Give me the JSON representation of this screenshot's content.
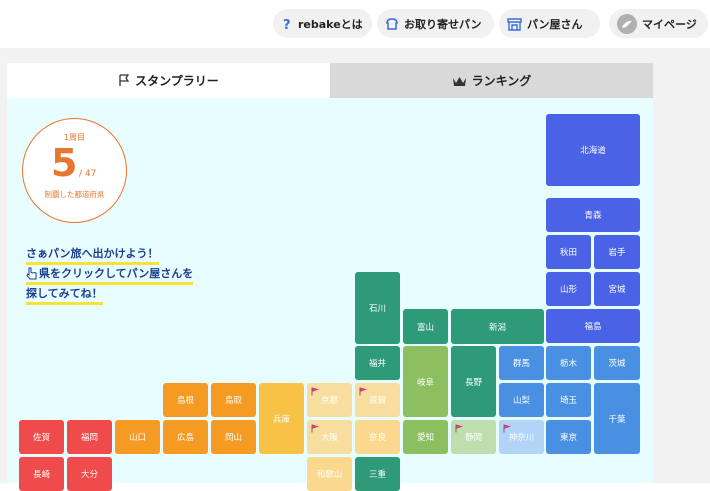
{
  "nav": {
    "about": "rebakeとは",
    "order": "お取り寄せパン",
    "bakery": "パン屋さん",
    "mypage": "マイページ"
  },
  "tabs": {
    "stamp": "スタンプラリー",
    "ranking": "ランキング"
  },
  "progress": {
    "lap": "1周目",
    "count": "5",
    "total": "/ 47",
    "caption": "制覇した都道府県"
  },
  "message": {
    "line1": "さぁパン旅へ出かけよう！",
    "line2": "県をクリックしてパン屋さんを",
    "line3": "探してみてね！"
  },
  "colors": {
    "accent": "#e8762e",
    "flag": "#e8147a",
    "hokkaido_tohoku": "#4a63e6",
    "kanto": "#4a90e2",
    "chubu_dark": "#2e9a78",
    "chubu_light": "#8cbf60",
    "kansai": "#fad98e",
    "chugoku": "#f59a23",
    "kyushu": "#f04b4b"
  },
  "prefectures": [
    {
      "name": "北海道",
      "visited": false
    },
    {
      "name": "青森",
      "visited": false
    },
    {
      "name": "秋田",
      "visited": false
    },
    {
      "name": "岩手",
      "visited": false
    },
    {
      "name": "山形",
      "visited": false
    },
    {
      "name": "宮城",
      "visited": false
    },
    {
      "name": "福島",
      "visited": false
    },
    {
      "name": "石川",
      "visited": false
    },
    {
      "name": "富山",
      "visited": false
    },
    {
      "name": "新潟",
      "visited": false
    },
    {
      "name": "福井",
      "visited": false
    },
    {
      "name": "岐阜",
      "visited": false
    },
    {
      "name": "長野",
      "visited": false
    },
    {
      "name": "群馬",
      "visited": false
    },
    {
      "name": "栃木",
      "visited": false
    },
    {
      "name": "茨城",
      "visited": false
    },
    {
      "name": "山梨",
      "visited": false
    },
    {
      "name": "埼玉",
      "visited": false
    },
    {
      "name": "千葉",
      "visited": false
    },
    {
      "name": "島根",
      "visited": false
    },
    {
      "name": "鳥取",
      "visited": false
    },
    {
      "name": "兵庫",
      "visited": false
    },
    {
      "name": "京都",
      "visited": true
    },
    {
      "name": "滋賀",
      "visited": true
    },
    {
      "name": "佐賀",
      "visited": false
    },
    {
      "name": "福岡",
      "visited": false
    },
    {
      "name": "山口",
      "visited": false
    },
    {
      "name": "広島",
      "visited": false
    },
    {
      "name": "岡山",
      "visited": false
    },
    {
      "name": "大阪",
      "visited": true
    },
    {
      "name": "奈良",
      "visited": false
    },
    {
      "name": "愛知",
      "visited": false
    },
    {
      "name": "静岡",
      "visited": true
    },
    {
      "name": "神奈川",
      "visited": true
    },
    {
      "name": "東京",
      "visited": false
    },
    {
      "name": "長崎",
      "visited": false
    },
    {
      "name": "大分",
      "visited": false
    },
    {
      "name": "和歌山",
      "visited": false
    },
    {
      "name": "三重",
      "visited": false
    }
  ]
}
